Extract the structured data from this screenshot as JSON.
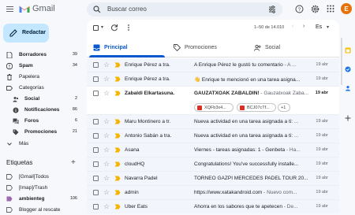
{
  "app": {
    "name": "Gmail",
    "avatar_letter": "E"
  },
  "search": {
    "placeholder": "Buscar correo"
  },
  "compose": {
    "label": "Redactar"
  },
  "nav": [
    {
      "label": "Borradores",
      "count": "39",
      "bold": true,
      "icon": "draft-icon"
    },
    {
      "label": "Spam",
      "count": "34",
      "bold": true,
      "icon": "spam-icon"
    },
    {
      "label": "Papelera",
      "count": "",
      "bold": false,
      "icon": "trash-icon"
    },
    {
      "label": "Categorías",
      "count": "",
      "bold": false,
      "icon": "label-icon"
    }
  ],
  "categories": [
    {
      "label": "Social",
      "count": "2",
      "icon": "people-icon"
    },
    {
      "label": "Notificaciones",
      "count": "86",
      "icon": "info-icon"
    },
    {
      "label": "Foros",
      "count": "6",
      "icon": "forum-icon"
    },
    {
      "label": "Promociones",
      "count": "21",
      "icon": "tag-icon"
    }
  ],
  "more": {
    "label": "Más"
  },
  "labels": {
    "title": "Etiquetas",
    "items": [
      {
        "label": "[Gmail]Todos",
        "count": "",
        "color": "#5f6368"
      },
      {
        "label": "[Imap]/Trash",
        "count": "",
        "color": "#5f6368"
      },
      {
        "label": "ambienteg",
        "count": "106",
        "color": "#9e69af"
      },
      {
        "label": "Blogger al rescate",
        "count": "",
        "color": "#5f6368"
      }
    ]
  },
  "toolbar": {
    "pager": "1–50 de 14.010",
    "lang": "Es"
  },
  "tabs": [
    {
      "label": "Principal",
      "icon": "inbox-icon",
      "active": true
    },
    {
      "label": "Promociones",
      "icon": "tag-icon",
      "active": false
    },
    {
      "label": "Social",
      "icon": "people-icon",
      "active": false
    }
  ],
  "emails": [
    {
      "sender": "Enrique Pérez a tra.",
      "subject": "A Enrique Pérez le gustó tu comentario",
      "snippet": " - A ...",
      "date": "19 abr",
      "unread": false
    },
    {
      "sender": "Enrique Pérez a tra.",
      "subject": "👋 Enrique te mencionó en una tarea asigna...",
      "snippet": "",
      "date": "19 abr",
      "unread": false
    },
    {
      "sender": "Zabaldi Elkartasuna.",
      "subject": "GAUZATXOAK ZABALDIN!",
      "snippet": " - Gauzatxoak Zaba...",
      "date": "19 abr",
      "unread": true,
      "attachments": [
        "XQFb3x4...",
        "BCJ07cTf...",
        "+1"
      ]
    },
    {
      "sender": "Maru Montinero a tr.",
      "subject": "Nueva actividad en una tarea asignada a ti:",
      "snippet": " ...",
      "date": "19 abr",
      "unread": false
    },
    {
      "sender": "Antonio Sabán a tra.",
      "subject": "Nueva actividad en una tarea asignada a ti:",
      "snippet": " ...",
      "date": "19 abr",
      "unread": false
    },
    {
      "sender": "Asana",
      "subject": "Viernes - tareas asignadas: 1 - Genbeta",
      "snippet": " - Ha...",
      "date": "19 abr",
      "unread": false
    },
    {
      "sender": "cloudHQ",
      "subject": "Congratulations! You've successfully installe...",
      "snippet": "",
      "date": "19 abr",
      "unread": false
    },
    {
      "sender": "Navarra Padel",
      "subject": "TORNEO GAZPI MERCEDES PADEL TOUR 20...",
      "snippet": "",
      "date": "19 abr",
      "unread": false
    },
    {
      "sender": "admin",
      "subject": "https://www.xatakandroid.com",
      "snippet": " - Nuevo com...",
      "date": "19 abr",
      "unread": false
    },
    {
      "sender": "Uber Eats",
      "subject": "Ahorra en los sabores que te apetecen",
      "snippet": " - De...",
      "date": "19 abr",
      "unread": false
    }
  ],
  "colors": {
    "accent": "#0b57d0",
    "compose_bg": "#c2e7ff",
    "avatar": "#e8710a",
    "background": "#f6f8fc"
  }
}
